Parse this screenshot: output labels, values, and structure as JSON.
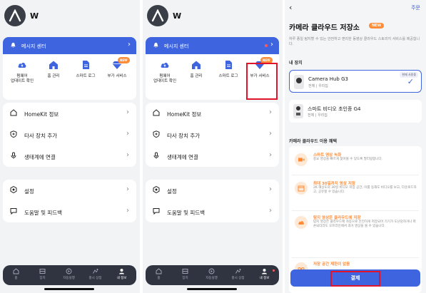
{
  "panel1": {
    "username": "W",
    "banner": {
      "label": "메시지 센터"
    },
    "quick": [
      {
        "label_line1": "펌웨어",
        "label_line2": "업데이트 확인",
        "icon": "cloud-upload-icon"
      },
      {
        "label_line1": "홈 관리",
        "label_line2": "",
        "icon": "home-icon"
      },
      {
        "label_line1": "스마트 로그",
        "label_line2": "",
        "icon": "document-icon"
      },
      {
        "label_line1": "부가 서비스",
        "label_line2": "",
        "icon": "diamond-icon",
        "badge": "NEW"
      }
    ],
    "menu1": [
      {
        "label": "HomeKit 정보",
        "icon": "home-outline-icon"
      },
      {
        "label": "타사 장치 추가",
        "icon": "shield-add-icon"
      },
      {
        "label": "생태계에 연결",
        "icon": "microphone-icon"
      }
    ],
    "menu2": [
      {
        "label": "설정",
        "icon": "settings-icon"
      },
      {
        "label": "도움말 및 피드백",
        "icon": "chat-icon"
      }
    ],
    "tabs": [
      {
        "label": "홈",
        "icon": "home-tab-icon"
      },
      {
        "label": "장치",
        "icon": "device-tab-icon"
      },
      {
        "label": "자동실행",
        "icon": "automation-tab-icon"
      },
      {
        "label": "홍시 상점",
        "icon": "store-tab-icon"
      },
      {
        "label": "내 정보",
        "icon": "profile-tab-icon"
      }
    ]
  },
  "panel2": {
    "username": "W",
    "banner": {
      "label": "메시지 센터"
    },
    "quick": [
      {
        "label_line1": "펌웨어",
        "label_line2": "업데이트 확인"
      },
      {
        "label_line1": "홈 관리",
        "label_line2": ""
      },
      {
        "label_line1": "스마트 로그",
        "label_line2": ""
      },
      {
        "label_line1": "부가 서비스",
        "label_line2": "",
        "badge": "NEW"
      }
    ],
    "menu1": [
      {
        "label": "HomeKit 정보"
      },
      {
        "label": "타사 장치 추가"
      },
      {
        "label": "생태계에 연결"
      }
    ],
    "menu2": [
      {
        "label": "설정"
      },
      {
        "label": "도움말 및 피드백"
      }
    ],
    "tabs": [
      {
        "label": "홈"
      },
      {
        "label": "장치"
      },
      {
        "label": "자동실행"
      },
      {
        "label": "홍시 상점"
      },
      {
        "label": "내 정보"
      }
    ]
  },
  "panel3": {
    "back_icon": "chevron-left-icon",
    "order_label": "주문",
    "title": "카메라 클라우드 저장소",
    "new_badge": "NEW",
    "description": "하루 종일 탐지할 수 있는 안전하고 편리한 동영상 클라우드 스토리지 서비스를 제공합니다.",
    "devices_header": "내 장치",
    "devices": [
      {
        "name": "Camera Hub G3",
        "sub": "전체 | 우리집",
        "tag": "현재 사용중",
        "selected": true
      },
      {
        "name": "스마트 비디오 초인종 G4",
        "sub": "전체 | 우리집",
        "tag": "",
        "selected": false
      }
    ],
    "benefits_header": "카메라 클라우드 이용 혜택",
    "benefits": [
      {
        "title": "스마트 영상 녹화",
        "desc": "중요 영상을 빠르게 찾아볼 수 있도록 필터링합니다."
      },
      {
        "title": "최대 30일까지 영상 저장",
        "desc": "2K 해상도의 30일 비디오 저장 공간, 이를 동해도 비디오를 보고, 다운로드하고, 공유할 수 있습니다."
      },
      {
        "title": "탐지 영상은 클라우드에 저장",
        "desc": "탐지 영상은 클라우드에 자동으로 안전하게 저장되어 기기가 도난당하거나 파손되더라도 오프라인에서 과거 영상을 볼 수 있습니다."
      },
      {
        "title": "저장 공간 제한이 없음",
        "desc": ""
      }
    ],
    "pay_button": "결제"
  }
}
